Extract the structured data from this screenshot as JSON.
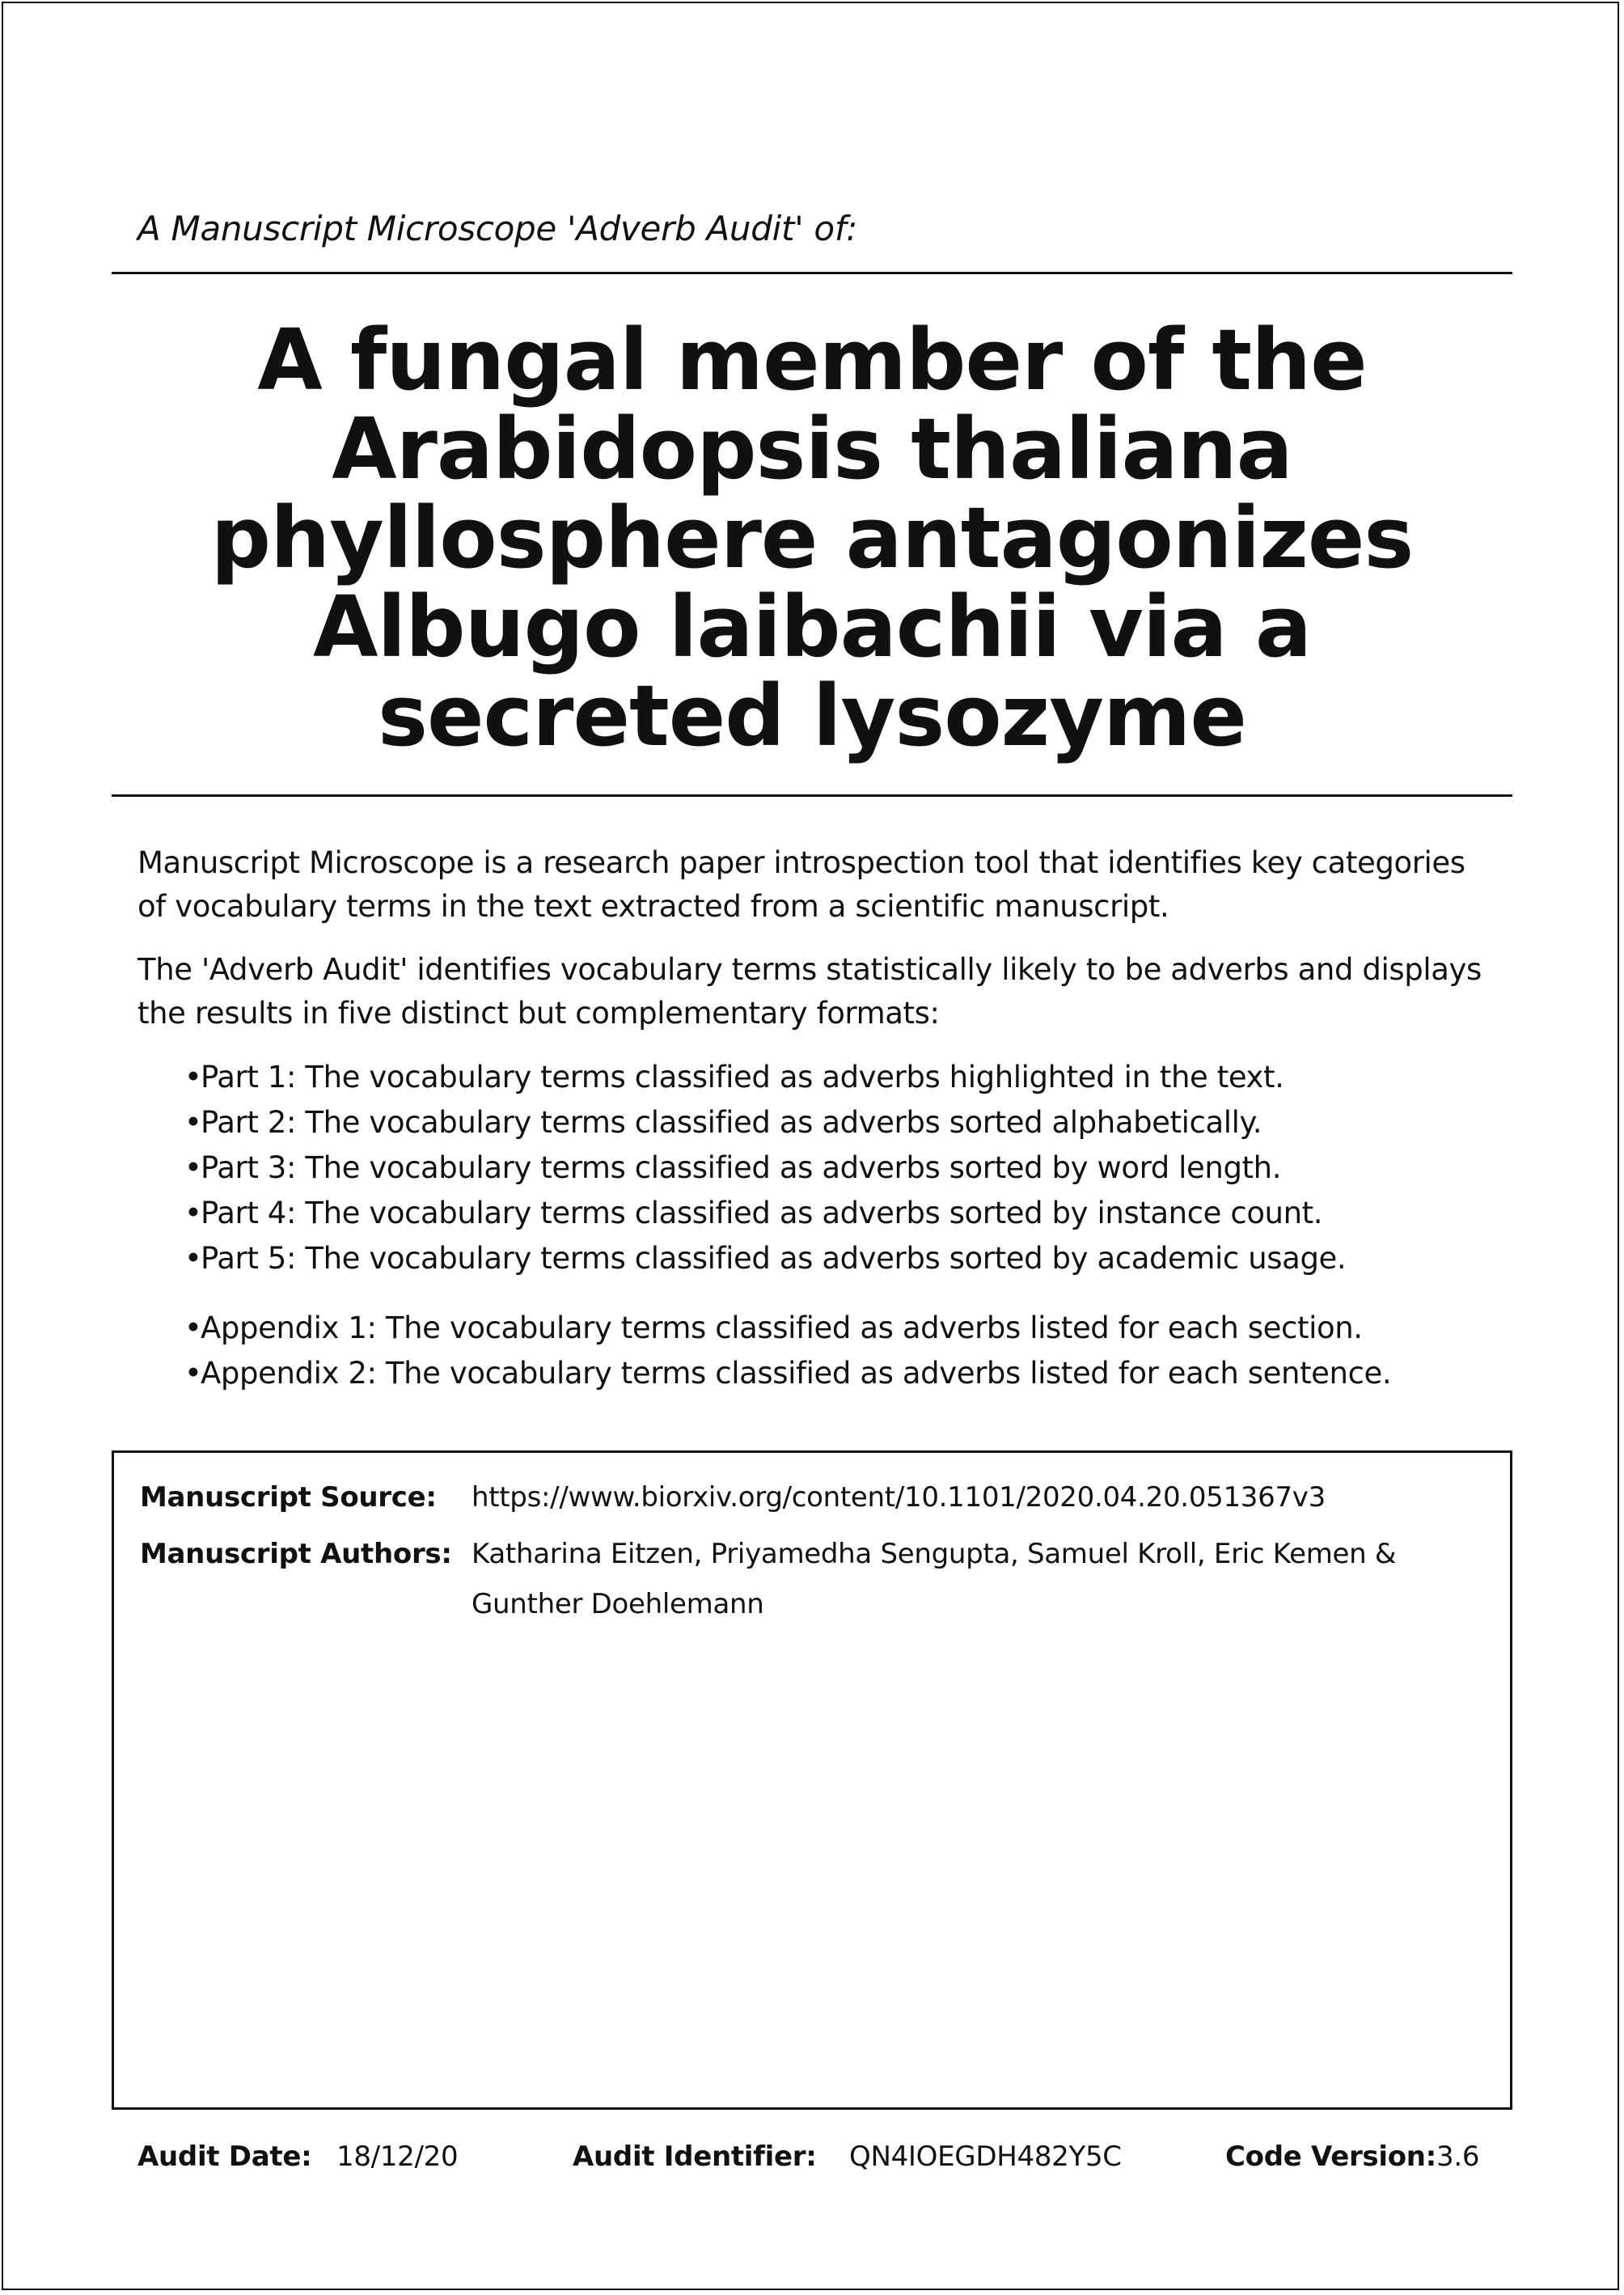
{
  "header": {
    "subtitle": "A Manuscript Microscope 'Adverb Audit' of:",
    "title": "A fungal member of the Arabidopsis thaliana phyllosphere antagonizes Albugo laibachii via a secreted lysozyme"
  },
  "intro": {
    "paragraph_1": "Manuscript Microscope is a research paper introspection tool that identifies key categories of vocabulary terms in the text extracted from a scientific manuscript.",
    "paragraph_2": "The 'Adverb Audit' identifies vocabulary terms statistically likely to be adverbs and displays the results in five distinct but complementary formats:",
    "parts": [
      "Part 1: The vocabulary terms classified as adverbs highlighted in the text.",
      "Part 2: The vocabulary terms classified as adverbs sorted alphabetically.",
      "Part 3: The vocabulary terms classified as adverbs sorted by word length.",
      "Part 4: The vocabulary terms classified as adverbs sorted by instance count.",
      "Part 5: The vocabulary terms classified as adverbs sorted by academic usage."
    ],
    "appendices": [
      "Appendix 1: The vocabulary terms classified as adverbs listed for each section.",
      "Appendix 2: The vocabulary terms classified as adverbs listed for each sentence."
    ]
  },
  "info": {
    "source_label": "Manuscript Source:",
    "source_value": "https://www.biorxiv.org/content/10.1101/2020.04.20.051367v3",
    "authors_label": "Manuscript Authors:",
    "authors_value": "Katharina Eitzen, Priyamedha Sengupta, Samuel Kroll, Eric Kemen & Gunther Doehlemann"
  },
  "footer": {
    "audit_date_label": "Audit Date:",
    "audit_date_value": "18/12/20",
    "audit_id_label": "Audit Identifier:",
    "audit_id_value": "QN4IOEGDH482Y5C",
    "code_version_label": "Code Version:",
    "code_version_value": "3.6"
  }
}
